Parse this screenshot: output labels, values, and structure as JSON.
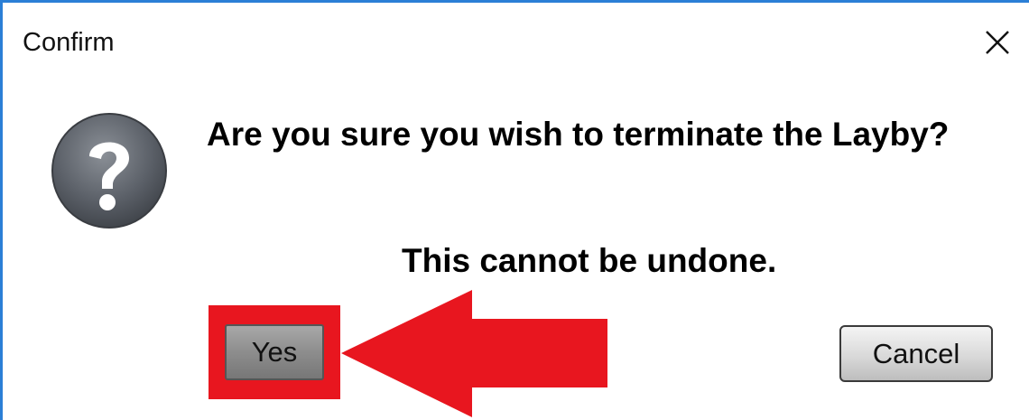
{
  "dialog": {
    "title": "Confirm",
    "close_glyph": "✕",
    "icon": "question-icon",
    "message": "Are you sure you wish to terminate the Layby?",
    "warning": "This cannot be undone.",
    "buttons": {
      "yes_label": "Yes",
      "cancel_label": "Cancel"
    }
  },
  "annotation": {
    "highlight_color": "#e8161f",
    "arrow_color": "#e8161f",
    "points_to": "yes-button"
  },
  "colors": {
    "window_border": "#2b7fd6",
    "icon_fill": "#5b6068"
  }
}
